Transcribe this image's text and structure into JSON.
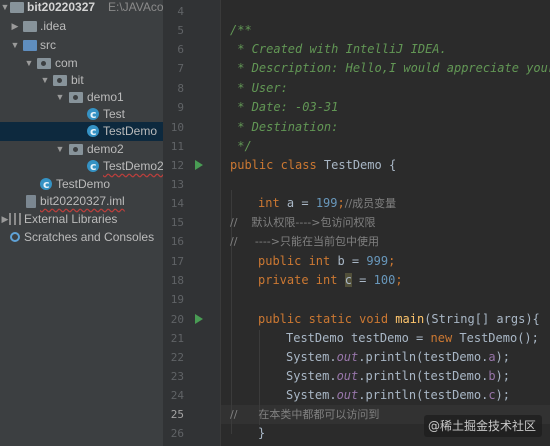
{
  "project_tree": [
    {
      "label": "bit20220327",
      "extra": "E:\\JAVAcode\\",
      "icon": "folder-icon",
      "expanded": true
    },
    {
      "label": ".idea",
      "icon": "folder-icon",
      "expanded": false
    },
    {
      "label": "src",
      "icon": "source-folder-icon",
      "expanded": true
    },
    {
      "label": "com",
      "icon": "package-icon",
      "expanded": true
    },
    {
      "label": "bit",
      "icon": "package-icon",
      "expanded": true
    },
    {
      "label": "demo1",
      "icon": "package-icon",
      "expanded": true
    },
    {
      "label": "Test",
      "icon": "java-class-icon"
    },
    {
      "label": "TestDemo",
      "icon": "java-class-icon",
      "selected": true
    },
    {
      "label": "demo2",
      "icon": "package-icon",
      "expanded": true
    },
    {
      "label": "TestDemo2",
      "icon": "java-class-icon"
    },
    {
      "label": "TestDemo",
      "icon": "java-class-icon"
    },
    {
      "label": "bit20220327.iml",
      "icon": "iml-file-icon"
    },
    {
      "label": "External Libraries",
      "icon": "library-icon"
    },
    {
      "label": "Scratches and Consoles",
      "icon": "scratches-icon"
    }
  ],
  "line_numbers": [
    "4",
    "5",
    "6",
    "7",
    "8",
    "9",
    "10",
    "11",
    "12",
    "13",
    "14",
    "15",
    "16",
    "17",
    "18",
    "19",
    "20",
    "21",
    "22",
    "23",
    "24",
    "25",
    "26"
  ],
  "current_line": "25",
  "code": {
    "l5": "/**",
    "l6": " * Created with IntelliJ IDEA.",
    "l7": " * Description: Hello,I would appreciate your",
    "l8": " * User:",
    "l9": " * Date: -03-31",
    "l10": " * Destination:",
    "l11": " */",
    "l12_kw": "public class ",
    "l12_name": "TestDemo {",
    "l14_kw": "int ",
    "l14_var": "a = ",
    "l14_num": "199",
    "l14_semi": ";",
    "l14_cmt": "//成员变量",
    "l15_cmt": "//    默认权限---->包访问权限",
    "l16_cmt": "//     ---->只能在当前包中使用",
    "l17_kw": "public int ",
    "l17_var": "b = ",
    "l17_num": "999",
    "l17_semi": ";",
    "l18_kw": "private int ",
    "l18_var": "c",
    "l18_eq": " = ",
    "l18_num": "100",
    "l18_semi": ";",
    "l20_kw": "public static void ",
    "l20_fn": "main",
    "l20_rest": "(String[] args){",
    "l21_a": "TestDemo testDemo = ",
    "l21_kw": "new ",
    "l21_b": "TestDemo();",
    "l22_a": "System.",
    "l22_out": "out",
    "l22_b": ".println(testDemo.",
    "l22_f": "a",
    "l22_c": ");",
    "l23_a": "System.",
    "l23_out": "out",
    "l23_b": ".println(testDemo.",
    "l23_f": "b",
    "l23_c": ");",
    "l24_a": "System.",
    "l24_out": "out",
    "l24_b": ".println(testDemo.",
    "l24_f": "c",
    "l24_c": ");",
    "l25_cmt": "//      在本类中都都可以访问到",
    "l26": "}"
  },
  "watermark": "@稀土掘金技术社区",
  "colors": {
    "keyword": "#cc7832",
    "number": "#6897bb",
    "doc_comment": "#629755",
    "line_comment": "#808080",
    "field": "#9876aa",
    "method": "#ffc66d"
  }
}
